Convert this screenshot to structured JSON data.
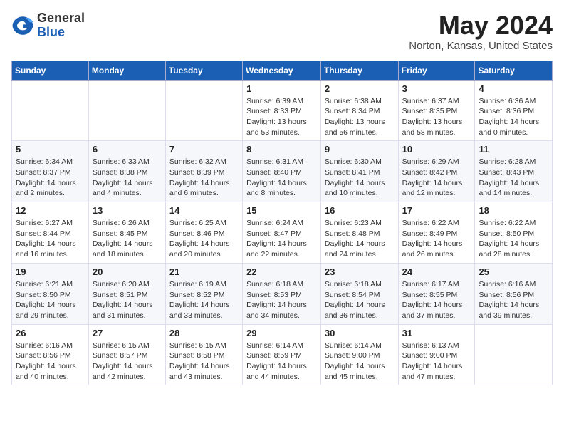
{
  "header": {
    "logo_general": "General",
    "logo_blue": "Blue",
    "month_title": "May 2024",
    "location": "Norton, Kansas, United States"
  },
  "days_of_week": [
    "Sunday",
    "Monday",
    "Tuesday",
    "Wednesday",
    "Thursday",
    "Friday",
    "Saturday"
  ],
  "weeks": [
    [
      {
        "day": "",
        "info": ""
      },
      {
        "day": "",
        "info": ""
      },
      {
        "day": "",
        "info": ""
      },
      {
        "day": "1",
        "info": "Sunrise: 6:39 AM\nSunset: 8:33 PM\nDaylight: 13 hours\nand 53 minutes."
      },
      {
        "day": "2",
        "info": "Sunrise: 6:38 AM\nSunset: 8:34 PM\nDaylight: 13 hours\nand 56 minutes."
      },
      {
        "day": "3",
        "info": "Sunrise: 6:37 AM\nSunset: 8:35 PM\nDaylight: 13 hours\nand 58 minutes."
      },
      {
        "day": "4",
        "info": "Sunrise: 6:36 AM\nSunset: 8:36 PM\nDaylight: 14 hours\nand 0 minutes."
      }
    ],
    [
      {
        "day": "5",
        "info": "Sunrise: 6:34 AM\nSunset: 8:37 PM\nDaylight: 14 hours\nand 2 minutes."
      },
      {
        "day": "6",
        "info": "Sunrise: 6:33 AM\nSunset: 8:38 PM\nDaylight: 14 hours\nand 4 minutes."
      },
      {
        "day": "7",
        "info": "Sunrise: 6:32 AM\nSunset: 8:39 PM\nDaylight: 14 hours\nand 6 minutes."
      },
      {
        "day": "8",
        "info": "Sunrise: 6:31 AM\nSunset: 8:40 PM\nDaylight: 14 hours\nand 8 minutes."
      },
      {
        "day": "9",
        "info": "Sunrise: 6:30 AM\nSunset: 8:41 PM\nDaylight: 14 hours\nand 10 minutes."
      },
      {
        "day": "10",
        "info": "Sunrise: 6:29 AM\nSunset: 8:42 PM\nDaylight: 14 hours\nand 12 minutes."
      },
      {
        "day": "11",
        "info": "Sunrise: 6:28 AM\nSunset: 8:43 PM\nDaylight: 14 hours\nand 14 minutes."
      }
    ],
    [
      {
        "day": "12",
        "info": "Sunrise: 6:27 AM\nSunset: 8:44 PM\nDaylight: 14 hours\nand 16 minutes."
      },
      {
        "day": "13",
        "info": "Sunrise: 6:26 AM\nSunset: 8:45 PM\nDaylight: 14 hours\nand 18 minutes."
      },
      {
        "day": "14",
        "info": "Sunrise: 6:25 AM\nSunset: 8:46 PM\nDaylight: 14 hours\nand 20 minutes."
      },
      {
        "day": "15",
        "info": "Sunrise: 6:24 AM\nSunset: 8:47 PM\nDaylight: 14 hours\nand 22 minutes."
      },
      {
        "day": "16",
        "info": "Sunrise: 6:23 AM\nSunset: 8:48 PM\nDaylight: 14 hours\nand 24 minutes."
      },
      {
        "day": "17",
        "info": "Sunrise: 6:22 AM\nSunset: 8:49 PM\nDaylight: 14 hours\nand 26 minutes."
      },
      {
        "day": "18",
        "info": "Sunrise: 6:22 AM\nSunset: 8:50 PM\nDaylight: 14 hours\nand 28 minutes."
      }
    ],
    [
      {
        "day": "19",
        "info": "Sunrise: 6:21 AM\nSunset: 8:50 PM\nDaylight: 14 hours\nand 29 minutes."
      },
      {
        "day": "20",
        "info": "Sunrise: 6:20 AM\nSunset: 8:51 PM\nDaylight: 14 hours\nand 31 minutes."
      },
      {
        "day": "21",
        "info": "Sunrise: 6:19 AM\nSunset: 8:52 PM\nDaylight: 14 hours\nand 33 minutes."
      },
      {
        "day": "22",
        "info": "Sunrise: 6:18 AM\nSunset: 8:53 PM\nDaylight: 14 hours\nand 34 minutes."
      },
      {
        "day": "23",
        "info": "Sunrise: 6:18 AM\nSunset: 8:54 PM\nDaylight: 14 hours\nand 36 minutes."
      },
      {
        "day": "24",
        "info": "Sunrise: 6:17 AM\nSunset: 8:55 PM\nDaylight: 14 hours\nand 37 minutes."
      },
      {
        "day": "25",
        "info": "Sunrise: 6:16 AM\nSunset: 8:56 PM\nDaylight: 14 hours\nand 39 minutes."
      }
    ],
    [
      {
        "day": "26",
        "info": "Sunrise: 6:16 AM\nSunset: 8:56 PM\nDaylight: 14 hours\nand 40 minutes."
      },
      {
        "day": "27",
        "info": "Sunrise: 6:15 AM\nSunset: 8:57 PM\nDaylight: 14 hours\nand 42 minutes."
      },
      {
        "day": "28",
        "info": "Sunrise: 6:15 AM\nSunset: 8:58 PM\nDaylight: 14 hours\nand 43 minutes."
      },
      {
        "day": "29",
        "info": "Sunrise: 6:14 AM\nSunset: 8:59 PM\nDaylight: 14 hours\nand 44 minutes."
      },
      {
        "day": "30",
        "info": "Sunrise: 6:14 AM\nSunset: 9:00 PM\nDaylight: 14 hours\nand 45 minutes."
      },
      {
        "day": "31",
        "info": "Sunrise: 6:13 AM\nSunset: 9:00 PM\nDaylight: 14 hours\nand 47 minutes."
      },
      {
        "day": "",
        "info": ""
      }
    ]
  ]
}
